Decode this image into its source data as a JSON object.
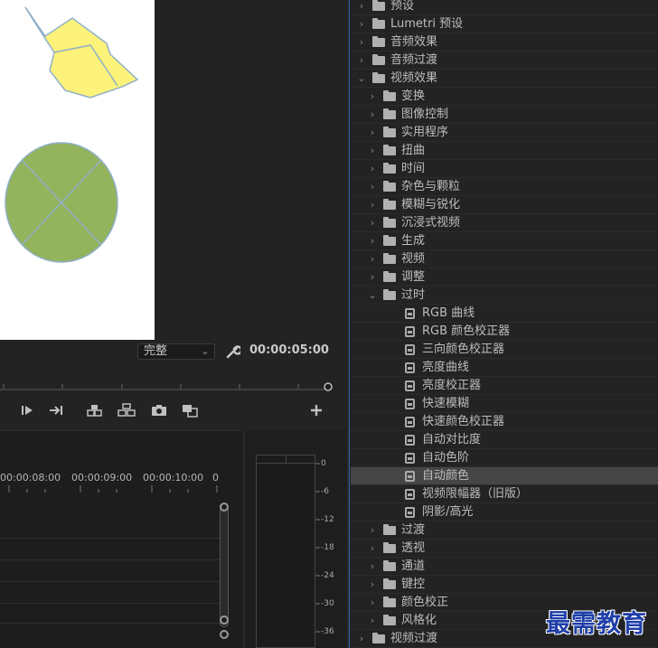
{
  "program_monitor": {
    "fit_value": "完整",
    "timecode": "00:00:05:00"
  },
  "timeline": {
    "ruler_times": [
      "00:00:08:00",
      "00:00:09:00",
      "00:00:10:00",
      "0"
    ]
  },
  "meter": {
    "db_labels": [
      "0",
      "-6",
      "-12",
      "-18",
      "-24",
      "-30",
      "-36"
    ]
  },
  "effects_tree": [
    {
      "label": "预设",
      "depth": 0,
      "type": "folder",
      "expanded": false
    },
    {
      "label": "Lumetri 预设",
      "depth": 0,
      "type": "folder-star",
      "expanded": false
    },
    {
      "label": "音频效果",
      "depth": 0,
      "type": "folder",
      "expanded": false
    },
    {
      "label": "音频过渡",
      "depth": 0,
      "type": "folder",
      "expanded": false
    },
    {
      "label": "视频效果",
      "depth": 0,
      "type": "folder",
      "expanded": true
    },
    {
      "label": "变换",
      "depth": 1,
      "type": "folder",
      "expanded": false
    },
    {
      "label": "图像控制",
      "depth": 1,
      "type": "folder",
      "expanded": false
    },
    {
      "label": "实用程序",
      "depth": 1,
      "type": "folder",
      "expanded": false
    },
    {
      "label": "扭曲",
      "depth": 1,
      "type": "folder",
      "expanded": false
    },
    {
      "label": "时间",
      "depth": 1,
      "type": "folder",
      "expanded": false
    },
    {
      "label": "杂色与颗粒",
      "depth": 1,
      "type": "folder",
      "expanded": false
    },
    {
      "label": "模糊与锐化",
      "depth": 1,
      "type": "folder",
      "expanded": false
    },
    {
      "label": "沉浸式视频",
      "depth": 1,
      "type": "folder",
      "expanded": false
    },
    {
      "label": "生成",
      "depth": 1,
      "type": "folder",
      "expanded": false
    },
    {
      "label": "视频",
      "depth": 1,
      "type": "folder",
      "expanded": false
    },
    {
      "label": "调整",
      "depth": 1,
      "type": "folder",
      "expanded": false
    },
    {
      "label": "过时",
      "depth": 1,
      "type": "folder",
      "expanded": true
    },
    {
      "label": "RGB 曲线",
      "depth": 2,
      "type": "effect"
    },
    {
      "label": "RGB 颜色校正器",
      "depth": 2,
      "type": "effect"
    },
    {
      "label": "三向颜色校正器",
      "depth": 2,
      "type": "effect"
    },
    {
      "label": "亮度曲线",
      "depth": 2,
      "type": "effect"
    },
    {
      "label": "亮度校正器",
      "depth": 2,
      "type": "effect"
    },
    {
      "label": "快速模糊",
      "depth": 2,
      "type": "effect"
    },
    {
      "label": "快速颜色校正器",
      "depth": 2,
      "type": "effect"
    },
    {
      "label": "自动对比度",
      "depth": 2,
      "type": "effect"
    },
    {
      "label": "自动色阶",
      "depth": 2,
      "type": "effect"
    },
    {
      "label": "自动颜色",
      "depth": 2,
      "type": "effect",
      "selected": true
    },
    {
      "label": "视频限幅器（旧版）",
      "depth": 2,
      "type": "effect"
    },
    {
      "label": "阴影/高光",
      "depth": 2,
      "type": "effect"
    },
    {
      "label": "过渡",
      "depth": 1,
      "type": "folder",
      "expanded": false
    },
    {
      "label": "透视",
      "depth": 1,
      "type": "folder",
      "expanded": false
    },
    {
      "label": "通道",
      "depth": 1,
      "type": "folder",
      "expanded": false
    },
    {
      "label": "键控",
      "depth": 1,
      "type": "folder",
      "expanded": false
    },
    {
      "label": "颜色校正",
      "depth": 1,
      "type": "folder",
      "expanded": false
    },
    {
      "label": "风格化",
      "depth": 1,
      "type": "folder",
      "expanded": false
    },
    {
      "label": "视频过渡",
      "depth": 0,
      "type": "folder",
      "expanded": false
    }
  ],
  "watermark": "最需教育",
  "colors": {
    "panel": "#232323",
    "accent": "#2d64b4",
    "selection": "#454545",
    "lemon": "#fdf27a",
    "green_circle": "#93b35c"
  }
}
